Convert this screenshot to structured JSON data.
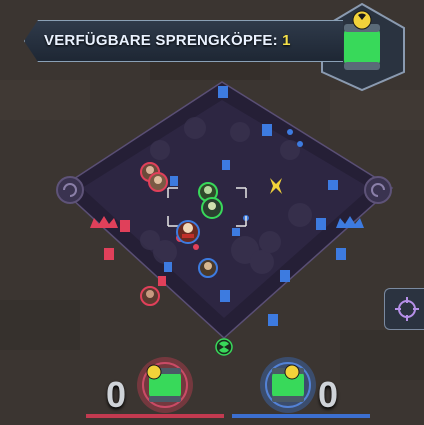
{
  "banner": {
    "label": "VERFÜGBARE SPRENGKÖPFE:",
    "count": "1"
  },
  "scores": {
    "red": "0",
    "blue": "0"
  },
  "colors": {
    "red_team": "#e0405a",
    "blue_team": "#3d7be0",
    "warhead_green": "#38d95a",
    "warhead_yellow": "#f2d23a",
    "map_floor": "#2c2540"
  }
}
